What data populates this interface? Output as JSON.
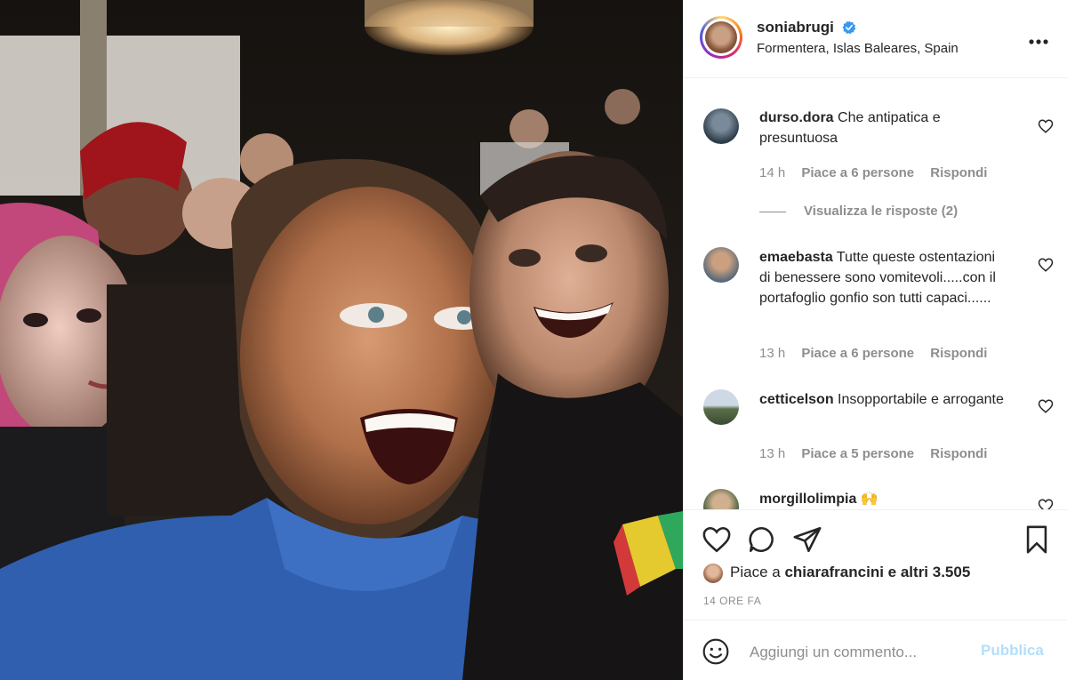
{
  "post": {
    "username": "soniabrugi",
    "verified": true,
    "location": "Formentera, Islas Baleares, Spain",
    "more_icon": "more-horizontal-icon"
  },
  "comments": [
    {
      "username": "durso.dora",
      "text": "Che antipatica e presuntuosa",
      "time": "14 h",
      "likes": "Piace a 6 persone",
      "reply": "Rispondi",
      "view_replies": "Visualizza le risposte (2)"
    },
    {
      "username": "emaebasta",
      "text": "Tutte queste ostentazioni di benessere sono vomitevoli.....con il portafoglio gonfio son tutti capaci......",
      "time": "13 h",
      "likes": "Piace a 6 persone",
      "reply": "Rispondi"
    },
    {
      "username": "cetticelson",
      "text": "Insopportabile e arrogante",
      "time": "13 h",
      "likes": "Piace a 5 persone",
      "reply": "Rispondi"
    },
    {
      "username": "morgillolimpia",
      "text": "🙌"
    }
  ],
  "likes_summary": {
    "prefix": "Piace a",
    "user": "chiarafrancini",
    "suffix": "e altri 3.505"
  },
  "timestamp": "14 ORE FA",
  "add_comment": {
    "placeholder": "Aggiungi un commento...",
    "publish": "Pubblica"
  },
  "colors": {
    "text": "#262626",
    "secondary": "#8e8e8e",
    "publish_disabled": "#b2dffc",
    "verified": "#3897f0"
  }
}
